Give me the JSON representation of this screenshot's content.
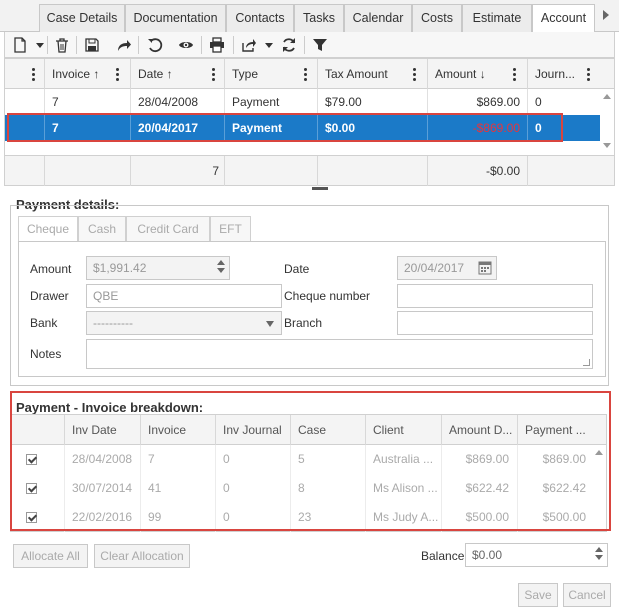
{
  "tabs": [
    {
      "label": "Case Details",
      "active": false
    },
    {
      "label": "Documentation",
      "active": false
    },
    {
      "label": "Contacts",
      "active": false
    },
    {
      "label": "Tasks",
      "active": false
    },
    {
      "label": "Calendar",
      "active": false
    },
    {
      "label": "Costs",
      "active": false
    },
    {
      "label": "Estimate",
      "active": false
    },
    {
      "label": "Account",
      "active": true
    }
  ],
  "toolbar": {
    "icons": [
      "new-document-icon",
      "delete-icon",
      "save-icon",
      "forward-icon",
      "undo-icon",
      "view-icon",
      "print-icon",
      "export-icon",
      "refresh-icon",
      "filter-icon"
    ]
  },
  "grid": {
    "columns": [
      "Invoice ↑",
      "Date ↑",
      "Type",
      "Tax Amount",
      "Amount ↓",
      "Journ..."
    ],
    "rows": [
      {
        "invoice": "7",
        "date": "28/04/2008",
        "type": "Payment",
        "tax": "$79.00",
        "amount": "$869.00",
        "journal": "0",
        "selected": false
      },
      {
        "invoice": "7",
        "date": "20/04/2017",
        "type": "Payment",
        "tax": "$0.00",
        "amount": "-$869.00",
        "journal": "0",
        "selected": true
      }
    ],
    "footer": {
      "invoice_total": "7",
      "amount_total": "-$0.00"
    }
  },
  "payment_details": {
    "title": "Payment details:",
    "method_tabs": [
      "Cheque",
      "Cash",
      "Credit Card",
      "EFT"
    ],
    "amount_label": "Amount",
    "amount_value": "$1,991.42",
    "date_label": "Date",
    "date_value": "20/04/2017",
    "drawer_label": "Drawer",
    "drawer_value": "QBE",
    "cheque_label": "Cheque number",
    "cheque_value": "",
    "bank_label": "Bank",
    "bank_value": "----------",
    "branch_label": "Branch",
    "branch_value": "",
    "notes_label": "Notes",
    "notes_value": ""
  },
  "breakdown": {
    "title": "Payment - Invoice breakdown:",
    "columns": [
      "Inv Date",
      "Invoice",
      "Inv Journal",
      "Case",
      "Client",
      "Amount D...",
      "Payment ..."
    ],
    "rows": [
      {
        "checked": true,
        "inv_date": "28/04/2008",
        "invoice": "7",
        "journal": "0",
        "case": "5",
        "client": "Australia ...",
        "amount": "$869.00",
        "payment": "$869.00"
      },
      {
        "checked": true,
        "inv_date": "30/07/2014",
        "invoice": "41",
        "journal": "0",
        "case": "8",
        "client": "Ms Alison ...",
        "amount": "$622.42",
        "payment": "$622.42"
      },
      {
        "checked": true,
        "inv_date": "22/02/2016",
        "invoice": "99",
        "journal": "0",
        "case": "23",
        "client": "Ms Judy A...",
        "amount": "$500.00",
        "payment": "$500.00"
      }
    ]
  },
  "bottom": {
    "allocate_all": "Allocate All",
    "clear_allocation": "Clear Allocation",
    "balance_label": "Balance",
    "balance_value": "$0.00",
    "save": "Save",
    "cancel": "Cancel"
  },
  "colors": {
    "selected_row": "#1b7ac8",
    "negative_amount": "#e8343a",
    "highlight_box": "#d9453f"
  }
}
